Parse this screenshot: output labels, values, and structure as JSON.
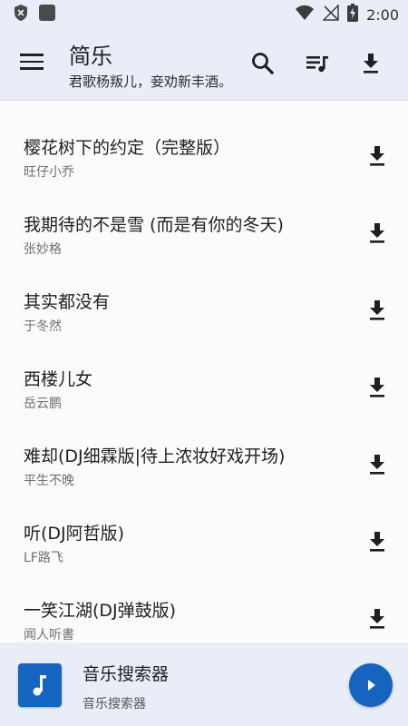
{
  "status_bar": {
    "time": "2:00",
    "icons": [
      "shield-x-icon",
      "app-square-icon",
      "wifi-icon",
      "no-signal-icon",
      "battery-charging-icon"
    ]
  },
  "app_bar": {
    "title": "简乐",
    "subtitle": "君歌杨叛儿，妾劝新丰酒。",
    "actions": [
      "menu-icon",
      "search-icon",
      "playlist-icon",
      "download-icon"
    ]
  },
  "songs": [
    {
      "title": "樱花树下的约定（完整版）",
      "artist": "旺仔小乔"
    },
    {
      "title": "我期待的不是雪 (而是有你的冬天)",
      "artist": "张妙格"
    },
    {
      "title": "其实都没有",
      "artist": "于冬然"
    },
    {
      "title": "西楼儿女",
      "artist": "岳云鹏"
    },
    {
      "title": "难却(DJ细霖版|待上浓妆好戏开场)",
      "artist": "平生不晚"
    },
    {
      "title": "听(DJ阿哲版)",
      "artist": "LF路飞"
    },
    {
      "title": "一笑江湖(DJ弹鼓版)",
      "artist": "闻人听書"
    }
  ],
  "player": {
    "title": "音乐搜索器",
    "subtitle": "音乐搜索器"
  },
  "colors": {
    "bar_bg": "#e9edf7",
    "accent": "#1565c0",
    "list_bg": "#fbfbfe"
  }
}
